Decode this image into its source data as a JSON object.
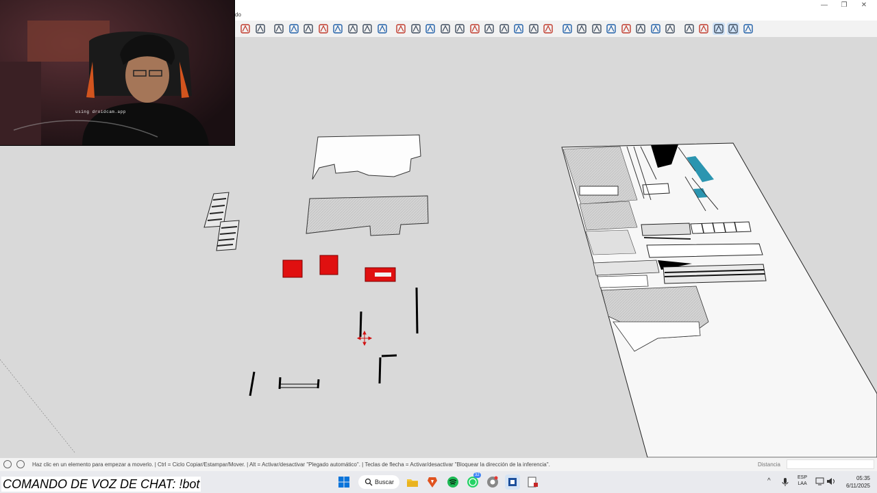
{
  "window": {
    "title_fragment": "do",
    "controls": [
      "—",
      "❐",
      "✕"
    ]
  },
  "toolbar": {
    "buttons": [
      "orbit-icon",
      "pan-icon",
      "zoom-icon",
      "zoom-extents-icon",
      "x-ray-icon",
      "back-edges-icon",
      "wireframe-icon",
      "hidden-line-icon",
      "shaded-icon",
      "monochrome-icon",
      "iso-view-icon",
      "top-view-icon",
      "front-view-icon",
      "right-view-icon",
      "back-view-icon",
      "left-view-icon",
      "components-icon",
      "groups-icon",
      "tag-icon",
      "sandbox-icon",
      "outliner-icon",
      "move-icon",
      "section-icon",
      "styles-icon",
      "materials-icon",
      "shadows-icon",
      "fog-icon",
      "match-photo-icon",
      "scenes-icon",
      "extension-icon",
      "warehouse-icon",
      "model-info-icon",
      "solid-icon",
      "trimble-icon"
    ]
  },
  "webcam": {
    "caption": "using droidcam.app"
  },
  "statusbar": {
    "text": "Haz clic en un elemento para empezar a moverlo. | Ctrl = Ciclo Copiar/Estampar/Mover. | Alt = Activar/desactivar \"Plegado automático\". | Teclas de flecha = Activar/desactivar \"Bloquear la dirección de la inferencia\".",
    "measure_label": "Distancia",
    "measure_value": ""
  },
  "overlay": {
    "chat_command": "COMANDO DE VOZ DE CHAT: !bot"
  },
  "taskbar": {
    "search_label": "Buscar",
    "apps": [
      "windows-start-icon",
      "search",
      "file-explorer-icon",
      "brave-browser-icon",
      "spotify-icon",
      "whatsapp-icon",
      "chrome-icon",
      "sketchup-icon",
      "layout-icon"
    ],
    "whatsapp_badge": "32",
    "lang_line1": "ESP",
    "lang_line2": "LAA",
    "time": "05:35",
    "date": "6/11/2025"
  },
  "colors": {
    "accent_red": "#e01010",
    "accent_teal": "#2b95b0",
    "viewport_bg": "#d9d9d9"
  }
}
